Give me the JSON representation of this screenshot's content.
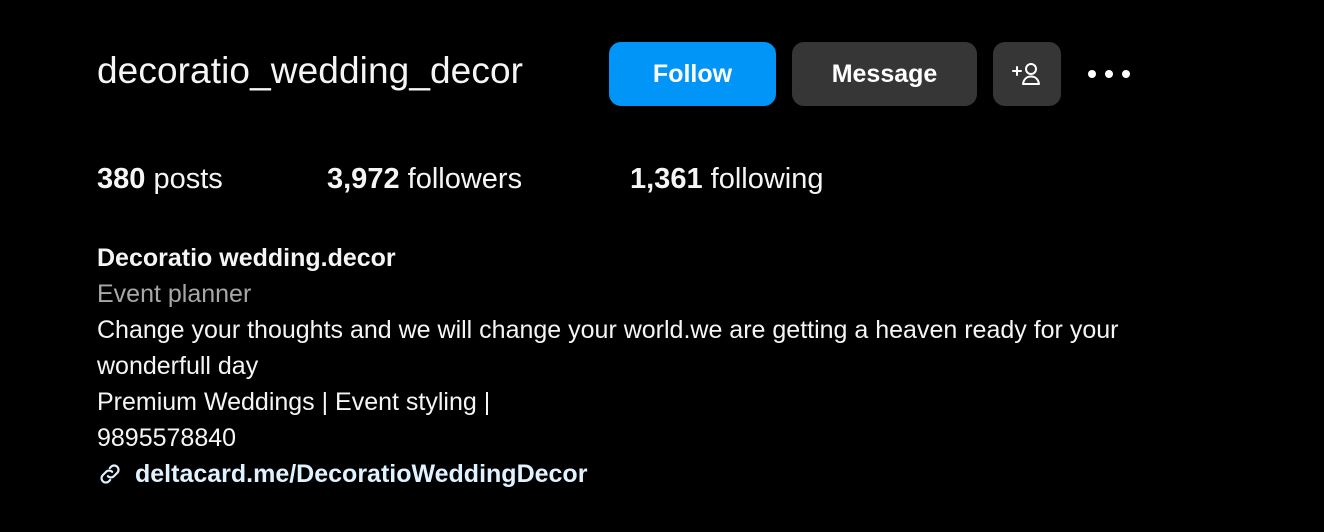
{
  "profile": {
    "username": "decoratio_wedding_decor",
    "follow_label": "Follow",
    "message_label": "Message",
    "add_user_icon": "add-person-icon",
    "more_icon": "more-horizontal-icon"
  },
  "stats": {
    "posts_count": "380",
    "posts_label": " posts",
    "followers_count": "3,972",
    "followers_label": " followers",
    "following_count": "1,361",
    "following_label": " following"
  },
  "bio": {
    "name": "Decoratio wedding.decor",
    "category": "Event planner",
    "text_line1": "Change your thoughts and we will change your world.we are getting a heaven ready for your",
    "text_line2": "wonderfull day",
    "text_line3": "Premium Weddings | Event styling |",
    "phone": "9895578840",
    "link": "deltacard.me/DecoratioWeddingDecor",
    "link_icon": "link-icon"
  },
  "colors": {
    "background": "#000000",
    "follow_button": "#0095f6",
    "secondary_button": "#363636",
    "category_text": "#a8a8a8",
    "link_text": "#e0f1ff"
  }
}
